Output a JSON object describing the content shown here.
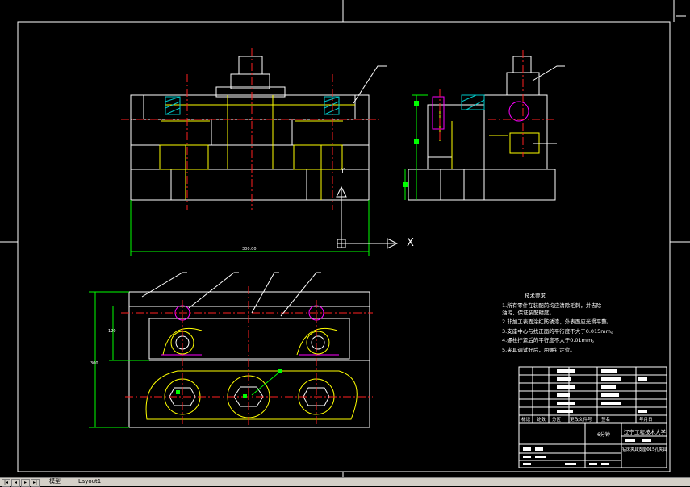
{
  "drawing": {
    "technical_requirements": {
      "title": "技术要求",
      "items": [
        "1.所有零件在装配前均应清除毛刺，并去除",
        "   油污，保证装配精度。",
        "2.非加工表面涂红防锈漆，外表面应光滑平整。",
        "3.支座中心与找正面的平行度不大于0.015mm。",
        "4.螺栓拧紧后的平行度不大于0.01mm。",
        "5.夹具调试好后，用螺钉定位。"
      ]
    },
    "title_block": {
      "university": "辽宁工程技术大学",
      "drawing_name": "钻床夹具支座Φ15孔夹具",
      "scale_mark": "6分钟",
      "headers": [
        "标记",
        "处数",
        "分区",
        "更改文件号",
        "签名",
        "年月日"
      ]
    },
    "dimensions": {
      "overall_width": "300.00",
      "height_a": "120",
      "height_b": "300"
    },
    "axes": {
      "x": "X",
      "y": "Y"
    }
  },
  "tabs": {
    "model": "模型",
    "layout": "Layout1"
  },
  "colors": {
    "background": "#000000",
    "outline": "#ffffff",
    "center_line": "#ff2020",
    "hidden": "#ffff00",
    "dimension": "#00ff00",
    "hatch": "#00c8c8",
    "highlight": "#ff00ff"
  }
}
